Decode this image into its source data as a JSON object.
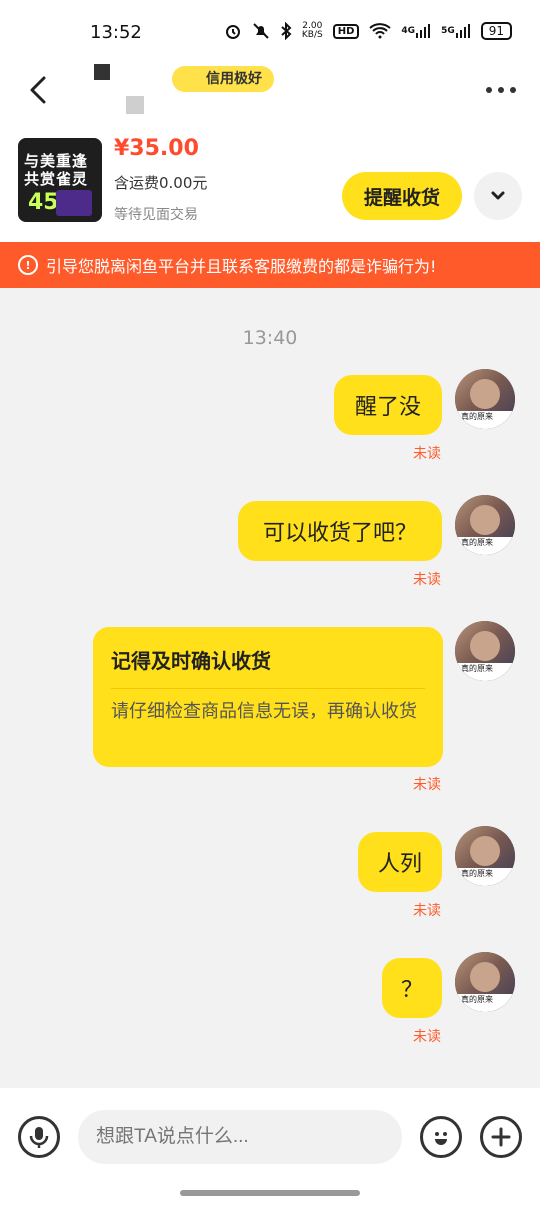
{
  "status_bar": {
    "time": "13:52",
    "net_speed_value": "2.00",
    "net_speed_unit": "KB/S",
    "hd_label": "HD",
    "signal1_label": "4G",
    "signal2_label": "5G",
    "battery": "91"
  },
  "header": {
    "tag_text": "信用极好"
  },
  "product": {
    "image_line1": "与美重逢",
    "image_line2": "共赏雀灵",
    "image_number": "45",
    "price": "¥35.00",
    "shipping": "含运费0.00元",
    "status": "等待见面交易",
    "remind_button": "提醒收货"
  },
  "warning": {
    "text": "引导您脱离闲鱼平台并且联系客服缴费的都是诈骗行为!"
  },
  "chat": {
    "timestamp": "13:40",
    "unread_label": "未读",
    "messages": [
      {
        "text": "醒了没"
      },
      {
        "text": "可以收货了吧？"
      },
      {
        "title": "记得及时确认收货",
        "body": "请仔细检查商品信息无误，再确认收货"
      },
      {
        "text": "人列"
      },
      {
        "text": "？"
      }
    ],
    "avatar_caption": "真的原来"
  },
  "bottom_bar": {
    "input_placeholder": "想跟TA说点什么..."
  },
  "colors": {
    "accent_yellow": "#ffe01a",
    "warning_orange": "#ff5a2a",
    "price_red": "#ff4a2e"
  },
  "icons": {
    "back": "chevron-left-icon",
    "more": "more-dots-icon",
    "expand": "chevron-down-icon",
    "warning": "warning-circle-icon",
    "mic": "microphone-icon",
    "emoji": "smile-icon",
    "plus": "plus-icon"
  }
}
